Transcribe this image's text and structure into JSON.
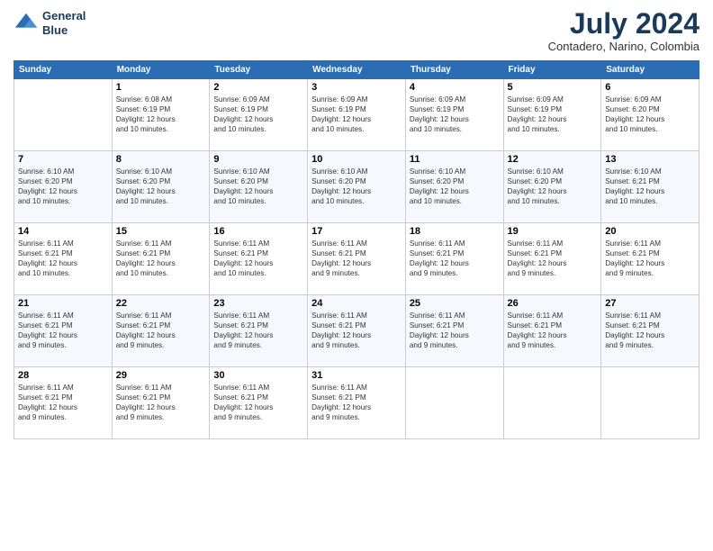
{
  "header": {
    "logo_line1": "General",
    "logo_line2": "Blue",
    "month": "July 2024",
    "location": "Contadero, Narino, Colombia"
  },
  "days_of_week": [
    "Sunday",
    "Monday",
    "Tuesday",
    "Wednesday",
    "Thursday",
    "Friday",
    "Saturday"
  ],
  "weeks": [
    [
      {
        "day": "",
        "info": ""
      },
      {
        "day": "1",
        "info": "Sunrise: 6:08 AM\nSunset: 6:19 PM\nDaylight: 12 hours\nand 10 minutes."
      },
      {
        "day": "2",
        "info": "Sunrise: 6:09 AM\nSunset: 6:19 PM\nDaylight: 12 hours\nand 10 minutes."
      },
      {
        "day": "3",
        "info": "Sunrise: 6:09 AM\nSunset: 6:19 PM\nDaylight: 12 hours\nand 10 minutes."
      },
      {
        "day": "4",
        "info": "Sunrise: 6:09 AM\nSunset: 6:19 PM\nDaylight: 12 hours\nand 10 minutes."
      },
      {
        "day": "5",
        "info": "Sunrise: 6:09 AM\nSunset: 6:19 PM\nDaylight: 12 hours\nand 10 minutes."
      },
      {
        "day": "6",
        "info": "Sunrise: 6:09 AM\nSunset: 6:20 PM\nDaylight: 12 hours\nand 10 minutes."
      }
    ],
    [
      {
        "day": "7",
        "info": "Sunrise: 6:10 AM\nSunset: 6:20 PM\nDaylight: 12 hours\nand 10 minutes."
      },
      {
        "day": "8",
        "info": "Sunrise: 6:10 AM\nSunset: 6:20 PM\nDaylight: 12 hours\nand 10 minutes."
      },
      {
        "day": "9",
        "info": "Sunrise: 6:10 AM\nSunset: 6:20 PM\nDaylight: 12 hours\nand 10 minutes."
      },
      {
        "day": "10",
        "info": "Sunrise: 6:10 AM\nSunset: 6:20 PM\nDaylight: 12 hours\nand 10 minutes."
      },
      {
        "day": "11",
        "info": "Sunrise: 6:10 AM\nSunset: 6:20 PM\nDaylight: 12 hours\nand 10 minutes."
      },
      {
        "day": "12",
        "info": "Sunrise: 6:10 AM\nSunset: 6:20 PM\nDaylight: 12 hours\nand 10 minutes."
      },
      {
        "day": "13",
        "info": "Sunrise: 6:10 AM\nSunset: 6:21 PM\nDaylight: 12 hours\nand 10 minutes."
      }
    ],
    [
      {
        "day": "14",
        "info": "Sunrise: 6:11 AM\nSunset: 6:21 PM\nDaylight: 12 hours\nand 10 minutes."
      },
      {
        "day": "15",
        "info": "Sunrise: 6:11 AM\nSunset: 6:21 PM\nDaylight: 12 hours\nand 10 minutes."
      },
      {
        "day": "16",
        "info": "Sunrise: 6:11 AM\nSunset: 6:21 PM\nDaylight: 12 hours\nand 10 minutes."
      },
      {
        "day": "17",
        "info": "Sunrise: 6:11 AM\nSunset: 6:21 PM\nDaylight: 12 hours\nand 9 minutes."
      },
      {
        "day": "18",
        "info": "Sunrise: 6:11 AM\nSunset: 6:21 PM\nDaylight: 12 hours\nand 9 minutes."
      },
      {
        "day": "19",
        "info": "Sunrise: 6:11 AM\nSunset: 6:21 PM\nDaylight: 12 hours\nand 9 minutes."
      },
      {
        "day": "20",
        "info": "Sunrise: 6:11 AM\nSunset: 6:21 PM\nDaylight: 12 hours\nand 9 minutes."
      }
    ],
    [
      {
        "day": "21",
        "info": "Sunrise: 6:11 AM\nSunset: 6:21 PM\nDaylight: 12 hours\nand 9 minutes."
      },
      {
        "day": "22",
        "info": "Sunrise: 6:11 AM\nSunset: 6:21 PM\nDaylight: 12 hours\nand 9 minutes."
      },
      {
        "day": "23",
        "info": "Sunrise: 6:11 AM\nSunset: 6:21 PM\nDaylight: 12 hours\nand 9 minutes."
      },
      {
        "day": "24",
        "info": "Sunrise: 6:11 AM\nSunset: 6:21 PM\nDaylight: 12 hours\nand 9 minutes."
      },
      {
        "day": "25",
        "info": "Sunrise: 6:11 AM\nSunset: 6:21 PM\nDaylight: 12 hours\nand 9 minutes."
      },
      {
        "day": "26",
        "info": "Sunrise: 6:11 AM\nSunset: 6:21 PM\nDaylight: 12 hours\nand 9 minutes."
      },
      {
        "day": "27",
        "info": "Sunrise: 6:11 AM\nSunset: 6:21 PM\nDaylight: 12 hours\nand 9 minutes."
      }
    ],
    [
      {
        "day": "28",
        "info": "Sunrise: 6:11 AM\nSunset: 6:21 PM\nDaylight: 12 hours\nand 9 minutes."
      },
      {
        "day": "29",
        "info": "Sunrise: 6:11 AM\nSunset: 6:21 PM\nDaylight: 12 hours\nand 9 minutes."
      },
      {
        "day": "30",
        "info": "Sunrise: 6:11 AM\nSunset: 6:21 PM\nDaylight: 12 hours\nand 9 minutes."
      },
      {
        "day": "31",
        "info": "Sunrise: 6:11 AM\nSunset: 6:21 PM\nDaylight: 12 hours\nand 9 minutes."
      },
      {
        "day": "",
        "info": ""
      },
      {
        "day": "",
        "info": ""
      },
      {
        "day": "",
        "info": ""
      }
    ]
  ]
}
